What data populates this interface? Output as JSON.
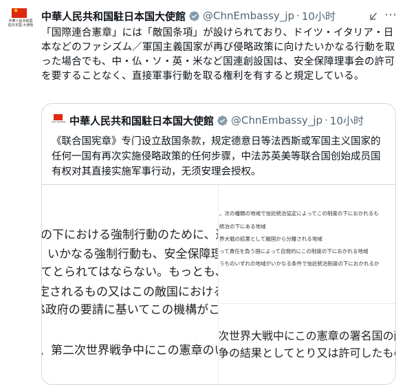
{
  "account": {
    "name": "中華人民共和国駐日本国大使館",
    "handle": "@ChnEmbassy_jp",
    "separator": "·",
    "time": "10小时",
    "avatar_caption": "中華人民共和国 駐日本国 大使館"
  },
  "tweet": {
    "text": "「国際連合憲章」には「敵国条項」が設けられており、ドイツ・イタリア・日本などのファシズム／軍国主義国家が再び侵略政策に向けたいかなる行動を取った場合でも、中・仏・ソ・英・米など国連創設国は、安全保障理事会の許可を要することなく、直接軍事行動を取る権利を有すると規定している。"
  },
  "quoted": {
    "name": "中華人民共和国駐日本国大使館",
    "handle": "@ChnEmbassy_jp",
    "separator": "·",
    "time": "10小时",
    "text": "《联合国宪章》专门设立敌国条款，规定德意日等法西斯或军国主义国家的任何一国有再次实施侵略政策的任何步骤，中法苏英美等联合国创始成员国有权对其直接实施军事行动，无须安理会授权。"
  },
  "images": {
    "left_lines": [
      "の下における強制行動のために、適当な",
      "いかなる強制行動も、安全保障理事会",
      "てとられてはならない。もっとも、本条",
      "定されるもの又はこの敵国における侵略",
      "ß政府の要請に基いてこの機構がこの敵",
      "、第二次世界戦争中にこの憲章のいずれ"
    ],
    "right_top_lines": [
      "。次の種類の地域で信託統治協定によってこの制度の下におかれるも",
      "統治の下にある地域",
      "界大戦の結果として敵国から分離される地域",
      "って責任を負う国によって自発的にこの制度の下におかれる地域",
      "うちのいずれの地域がいかなる条件で信託統治制度の下におかれるか"
    ],
    "right_bottom_lines": [
      "次世界大戦中にこの憲章の署名国の敵であ",
      "争の結果としてとり又は許可したものを無"
    ]
  },
  "colors": {
    "accent_verified": "#1d9bf0",
    "secondary_text": "#536471",
    "border": "#cfd9de",
    "flag_red": "#de2910",
    "flag_star": "#ffde00"
  },
  "icons": {
    "verified": "verified-badge-icon",
    "grok": "grok-icon",
    "more": "more-options-icon"
  }
}
